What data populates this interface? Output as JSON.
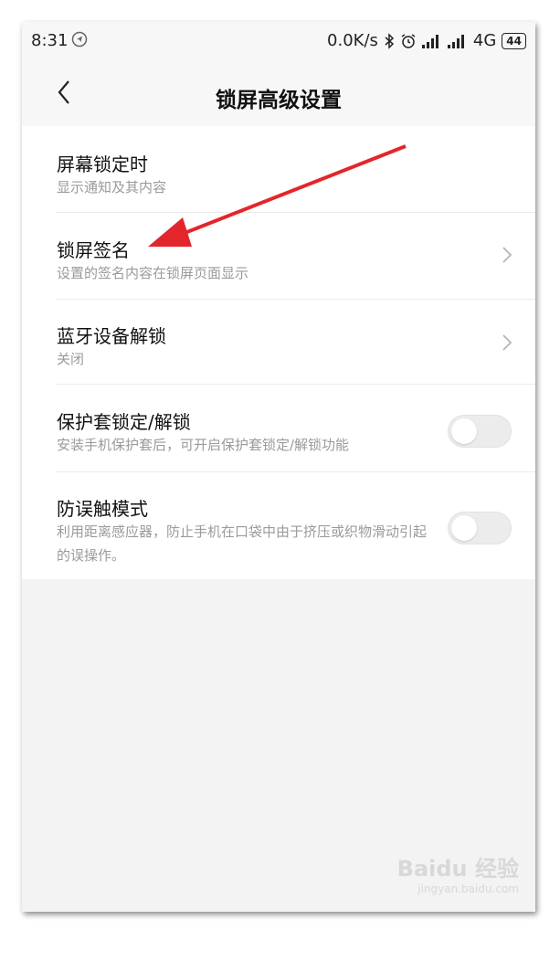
{
  "status_bar": {
    "time": "8:31",
    "network_speed": "0.0K/s",
    "network_type": "4G",
    "battery": "44"
  },
  "header": {
    "title": "锁屏高级设置"
  },
  "settings": {
    "items": [
      {
        "title": "屏幕锁定时",
        "subtitle": "显示通知及其内容",
        "control": "none"
      },
      {
        "title": "锁屏签名",
        "subtitle": "设置的签名内容在锁屏页面显示",
        "control": "chevron"
      },
      {
        "title": "蓝牙设备解锁",
        "subtitle": "关闭",
        "control": "chevron"
      },
      {
        "title": "保护套锁定/解锁",
        "subtitle": "安装手机保护套后，可开启保护套锁定/解锁功能",
        "control": "toggle",
        "enabled": false
      },
      {
        "title": "防误触模式",
        "subtitle": "利用距离感应器，防止手机在口袋中由于挤压或织物滑动引起的误操作。",
        "control": "toggle",
        "enabled": false
      }
    ]
  },
  "annotation": {
    "arrow_color": "#e3262b"
  },
  "watermark": {
    "main": "Baidu 经验",
    "sub": "jingyan.baidu.com"
  },
  "colors": {
    "background": "#f3f3f3",
    "card": "#ffffff",
    "subtitle": "#9a9a9a"
  }
}
